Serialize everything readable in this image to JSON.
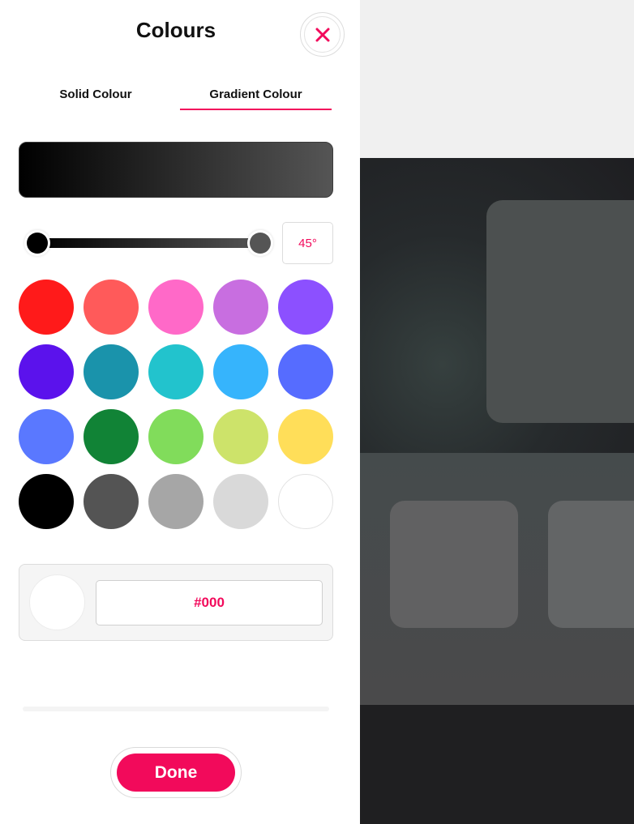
{
  "panel": {
    "title": "Colours",
    "close_icon": "close-icon",
    "tabs": [
      {
        "label": "Solid Colour",
        "active": false
      },
      {
        "label": "Gradient Colour",
        "active": true
      }
    ],
    "gradient": {
      "start_color": "#000000",
      "end_color": "#555555",
      "angle_label": "45°"
    },
    "swatches": [
      "#ff1a1a",
      "#ff5a5a",
      "#ff69c8",
      "#c86ee0",
      "#8c50ff",
      "#5b12ec",
      "#1a93ab",
      "#22c3cd",
      "#36b4fc",
      "#566cff",
      "#5a78ff",
      "#118336",
      "#81dc5b",
      "#cde36a",
      "#ffde59",
      "#000000",
      "#545454",
      "#a6a6a6",
      "#d9d9d9",
      "#ffffff"
    ],
    "hex": {
      "value": "#000",
      "preview_color": "#ffffff"
    },
    "done_label": "Done"
  },
  "colors": {
    "accent": "#f20a5b"
  }
}
